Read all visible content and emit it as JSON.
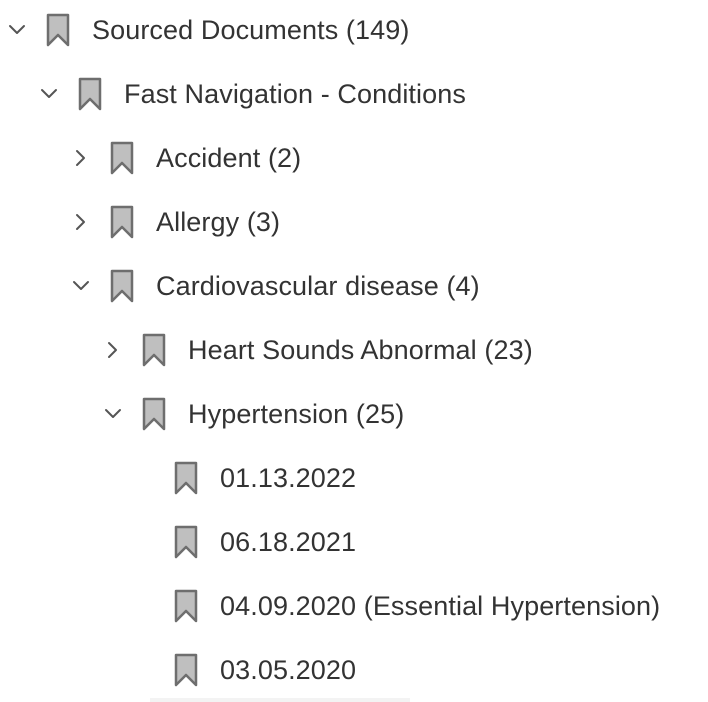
{
  "colors": {
    "text": "#333333",
    "icon_fill": "#bfbfbf",
    "icon_stroke": "#6e6e6e",
    "chevron": "#555555",
    "background": "#ffffff"
  },
  "icons": {
    "toggle": "chevron",
    "node": "bookmark-icon"
  },
  "tree": [
    {
      "label": "Sourced Documents (149)",
      "level": 0,
      "state": "expanded"
    },
    {
      "label": "Fast Navigation - Conditions",
      "level": 1,
      "state": "expanded"
    },
    {
      "label": "Accident (2)",
      "level": 2,
      "state": "collapsed"
    },
    {
      "label": "Allergy (3)",
      "level": 2,
      "state": "collapsed"
    },
    {
      "label": "Cardiovascular disease (4)",
      "level": 2,
      "state": "expanded"
    },
    {
      "label": "Heart Sounds Abnormal (23)",
      "level": 3,
      "state": "collapsed"
    },
    {
      "label": "Hypertension (25)",
      "level": 3,
      "state": "expanded"
    },
    {
      "label": "01.13.2022",
      "level": 4,
      "state": "leaf"
    },
    {
      "label": "06.18.2021",
      "level": 4,
      "state": "leaf"
    },
    {
      "label": "04.09.2020 (Essential Hypertension)",
      "level": 4,
      "state": "leaf"
    },
    {
      "label": "03.05.2020",
      "level": 4,
      "state": "leaf"
    }
  ]
}
